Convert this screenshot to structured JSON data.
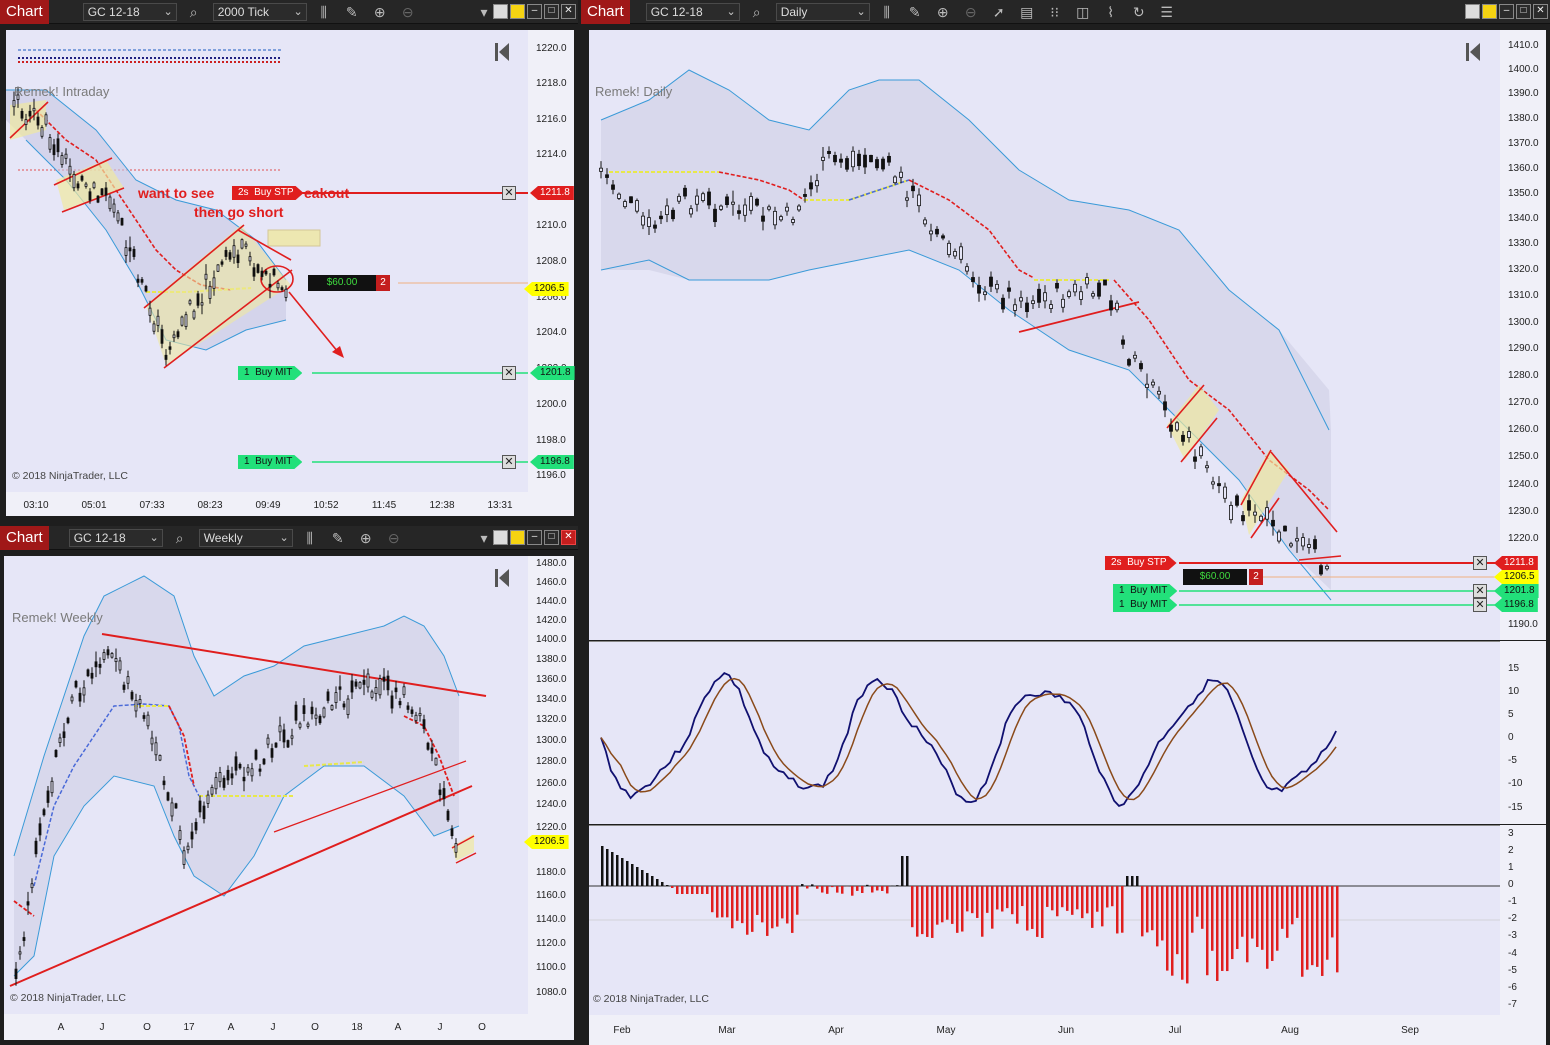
{
  "win1": {
    "tab": "Chart",
    "instrument": "GC 12-18",
    "interval": "2000 Tick",
    "title": "Remek! Intraday",
    "copyright": "© 2018 NinjaTrader, LLC",
    "yticks": [
      "1220.0",
      "1218.0",
      "1216.0",
      "1214.0",
      "1212.0",
      "1210.0",
      "1208.0",
      "1206.0",
      "1204.0",
      "1202.0",
      "1200.0",
      "1198.0",
      "1196.0"
    ],
    "xticks": [
      "03:10",
      "05:01",
      "07:33",
      "08:23",
      "09:49",
      "10:52",
      "11:45",
      "12:38",
      "13:31"
    ],
    "ann1": "want to see",
    "ann1b": "eakout",
    "ann2": "then go short",
    "buy_stp": {
      "qty": "2s",
      "label": "Buy STP",
      "price": "1211.8"
    },
    "last": "1206.5",
    "pnl": "$60.00",
    "pos_qty": "2",
    "mit1": {
      "qty": "1",
      "label": "Buy MIT",
      "price": "1201.8"
    },
    "mit2": {
      "qty": "1",
      "label": "Buy MIT",
      "price": "1196.8"
    }
  },
  "win2": {
    "tab": "Chart",
    "instrument": "GC 12-18",
    "interval": "Daily",
    "title": "Remek! Daily",
    "copyright": "© 2018 NinjaTrader, LLC",
    "yticks": [
      "1410.0",
      "1400.0",
      "1390.0",
      "1380.0",
      "1370.0",
      "1360.0",
      "1350.0",
      "1340.0",
      "1330.0",
      "1320.0",
      "1310.0",
      "1300.0",
      "1290.0",
      "1280.0",
      "1270.0",
      "1260.0",
      "1250.0",
      "1240.0",
      "1230.0",
      "1220.0",
      "1190.0"
    ],
    "osc_ticks": [
      "15",
      "10",
      "5",
      "0",
      "-5",
      "-10",
      "-15"
    ],
    "hist_ticks": [
      "3",
      "2",
      "1",
      "0",
      "-1",
      "-2",
      "-3",
      "-4",
      "-5",
      "-6",
      "-7"
    ],
    "xticks": [
      "Feb",
      "Mar",
      "Apr",
      "May",
      "Jun",
      "Jul",
      "Aug",
      "Sep"
    ],
    "buy_stp": {
      "qty": "2s",
      "label": "Buy STP",
      "price": "1211.8"
    },
    "last": "1206.5",
    "pnl": "$60.00",
    "pos_qty": "2",
    "mit1": {
      "qty": "1",
      "label": "Buy MIT",
      "price": "1201.8"
    },
    "mit2": {
      "qty": "1",
      "label": "Buy MIT",
      "price": "1196.8"
    }
  },
  "win3": {
    "tab": "Chart",
    "instrument": "GC 12-18",
    "interval": "Weekly",
    "title": "Remek! Weekly",
    "copyright": "© 2018 NinjaTrader, LLC",
    "yticks": [
      "1480.0",
      "1460.0",
      "1440.0",
      "1420.0",
      "1400.0",
      "1380.0",
      "1360.0",
      "1340.0",
      "1320.0",
      "1300.0",
      "1280.0",
      "1260.0",
      "1240.0",
      "1220.0",
      "1180.0",
      "1160.0",
      "1140.0",
      "1120.0",
      "1100.0",
      "1080.0"
    ],
    "xticks": [
      "A",
      "J",
      "O",
      "17",
      "A",
      "J",
      "O",
      "18",
      "A",
      "J",
      "O"
    ],
    "last": "1206.5"
  },
  "colors": {
    "tab": "#a01818",
    "plot_bg": "#e6e6f7",
    "order_red": "#e01e1e",
    "order_green": "#22e07a",
    "last_yellow": "#ffff00"
  }
}
